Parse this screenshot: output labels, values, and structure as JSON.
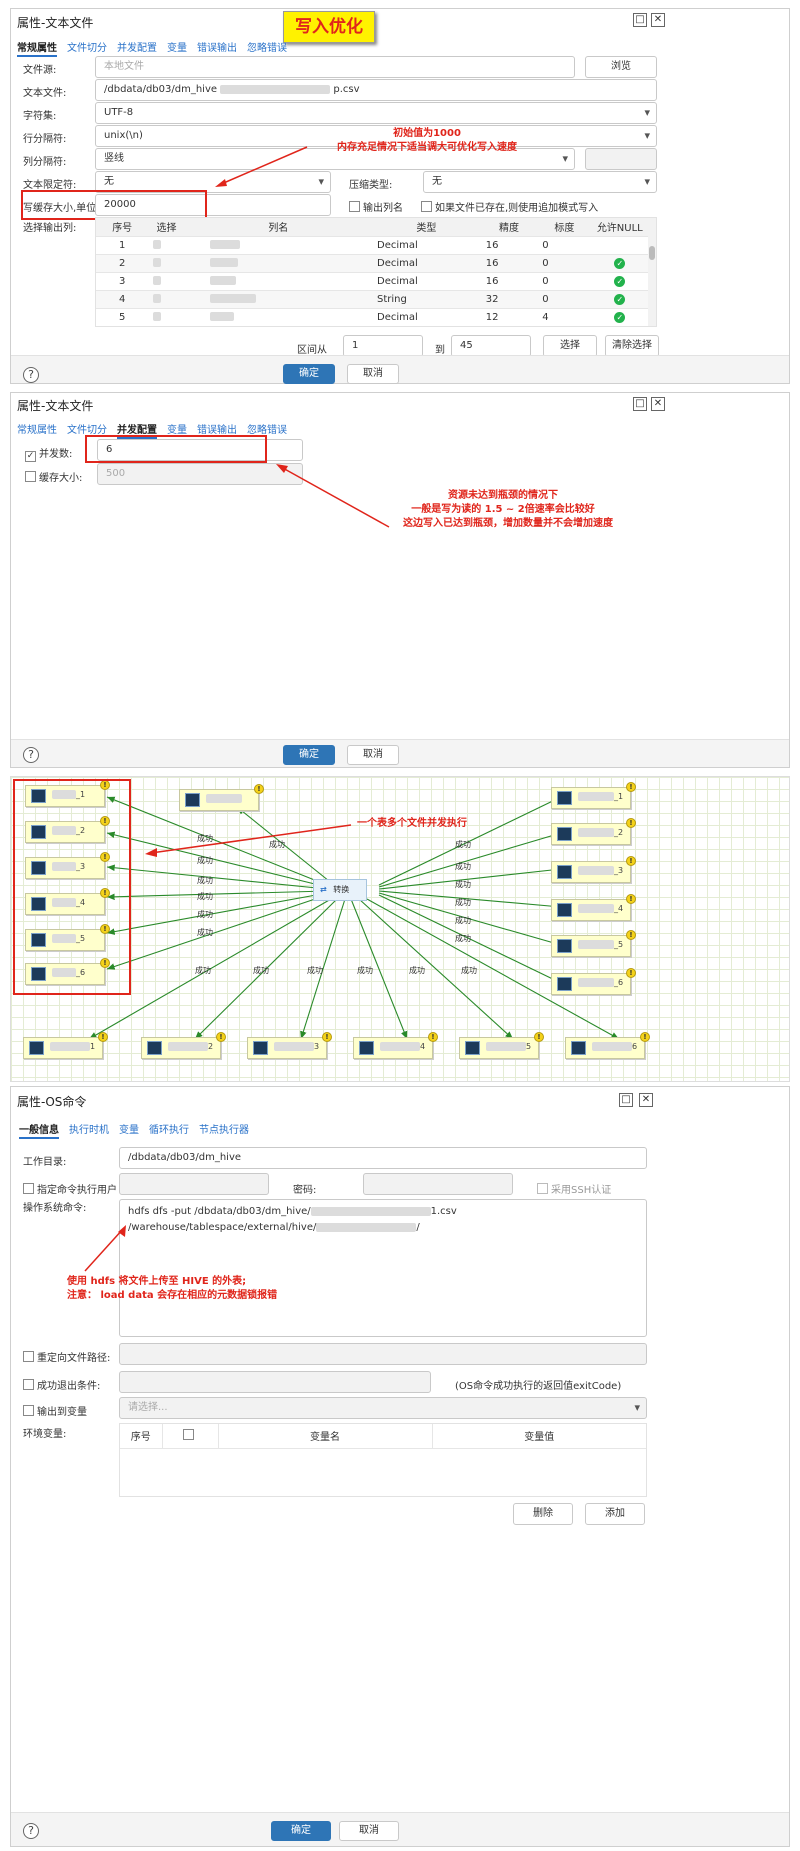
{
  "top_banner": "写入优化",
  "panel1": {
    "title": "属性-文本文件",
    "tabs": [
      "常规属性",
      "文件切分",
      "并发配置",
      "变量",
      "错误输出",
      "忽略错误"
    ],
    "file_source_label": "文件源:",
    "file_source_placeholder": "本地文件",
    "browse": "浏览",
    "file_label": "文本文件:",
    "file_value_prefix": "/dbdata/db03/dm_hive",
    "file_value_suffix": "p.csv",
    "charset_label": "字符集:",
    "charset_value": "UTF-8",
    "row_sep_label": "行分隔符:",
    "row_sep_value": "unix(\\n)",
    "col_sep_label": "列分隔符:",
    "col_sep_value": "竖线",
    "qualifier_label": "文本限定符:",
    "qualifier_value": "无",
    "compress_label": "压缩类型:",
    "compress_value": "无",
    "cache_label": "写缓存大小,单位M:",
    "cache_value": "20000",
    "output_colname": "输出列名",
    "append_label": "如果文件已存在,则使用追加模式写入",
    "select_cols_label": "选择输出列:",
    "columns": [
      "序号",
      "选择",
      "列名",
      "类型",
      "精度",
      "标度",
      "允许NULL"
    ],
    "rows": [
      {
        "idx": "1",
        "type": "Decimal",
        "prec": "16",
        "scale": "0"
      },
      {
        "idx": "2",
        "type": "Decimal",
        "prec": "16",
        "scale": "0"
      },
      {
        "idx": "3",
        "type": "Decimal",
        "prec": "16",
        "scale": "0"
      },
      {
        "idx": "4",
        "type": "String",
        "prec": "32",
        "scale": "0"
      },
      {
        "idx": "5",
        "type": "Decimal",
        "prec": "12",
        "scale": "4"
      }
    ],
    "range_from_label": "区间从",
    "range_from": "1",
    "range_to_label": "到",
    "range_to": "45",
    "select_btn": "选择",
    "clear_btn": "清除选择",
    "ok": "确定",
    "cancel": "取消",
    "annotation_line1": "初始值为1000",
    "annotation_line2": "内存充足情况下适当调大可优化写入速度"
  },
  "panel2": {
    "title": "属性-文本文件",
    "tabs": [
      "常规属性",
      "文件切分",
      "并发配置",
      "变量",
      "错误输出",
      "忽略错误"
    ],
    "concurrency_label": "并发数:",
    "concurrency_value": "6",
    "buffer_label": "缓存大小:",
    "buffer_value": "500",
    "annotation_line1": "资源未达到瓶颈的情况下",
    "annotation_line2": "一般是写为读的 1.5 ~ 2倍速率会比较好",
    "annotation_line3": "这边写入已达到瓶颈，增加数量并不会增加速度",
    "ok": "确定",
    "cancel": "取消"
  },
  "flow": {
    "center_label": "转换",
    "edge_label": "成功",
    "annotation": "一个表多个文件并发执行",
    "left_nodes": [
      "_1",
      "_2",
      "_3",
      "_4",
      "_5",
      "_6"
    ],
    "right_nodes": [
      "_1",
      "_2",
      "_3",
      "_4",
      "_5",
      "_6"
    ],
    "bottom_nodes": [
      "1",
      "2",
      "3",
      "4",
      "5",
      "6"
    ]
  },
  "panel3": {
    "title": "属性-OS命令",
    "tabs": [
      "一般信息",
      "执行时机",
      "变量",
      "循环执行",
      "节点执行器"
    ],
    "workdir_label": "工作目录:",
    "workdir_value": "/dbdata/db03/dm_hive",
    "specify_user_label": "指定命令执行用户",
    "password_label": "密码:",
    "ssh_label": "采用SSH认证",
    "cmd_label": "操作系统命令:",
    "cmd_line1_prefix": "hdfs dfs -put /dbdata/db03/dm_hive/",
    "cmd_line1_suffix": "1.csv",
    "cmd_line2_prefix": "/warehouse/tablespace/external/hive/",
    "cmd_line2_suffix": "/",
    "annotation_line1": "使用 hdfs 将文件上传至 HIVE 的外表;",
    "annotation_line2": "注意： load data 会存在相应的元数据锁报错",
    "redirect_label": "重定向文件路径:",
    "exit_label": "成功退出条件:",
    "exit_hint": "(OS命令成功执行的返回值exitCode)",
    "output_var_label": "输出到变量",
    "output_var_placeholder": "请选择...",
    "env_label": "环境变量:",
    "env_columns": [
      "序号",
      "",
      "变量名",
      "变量值"
    ],
    "delete_btn": "删除",
    "add_btn": "添加",
    "ok": "确定",
    "cancel": "取消"
  }
}
